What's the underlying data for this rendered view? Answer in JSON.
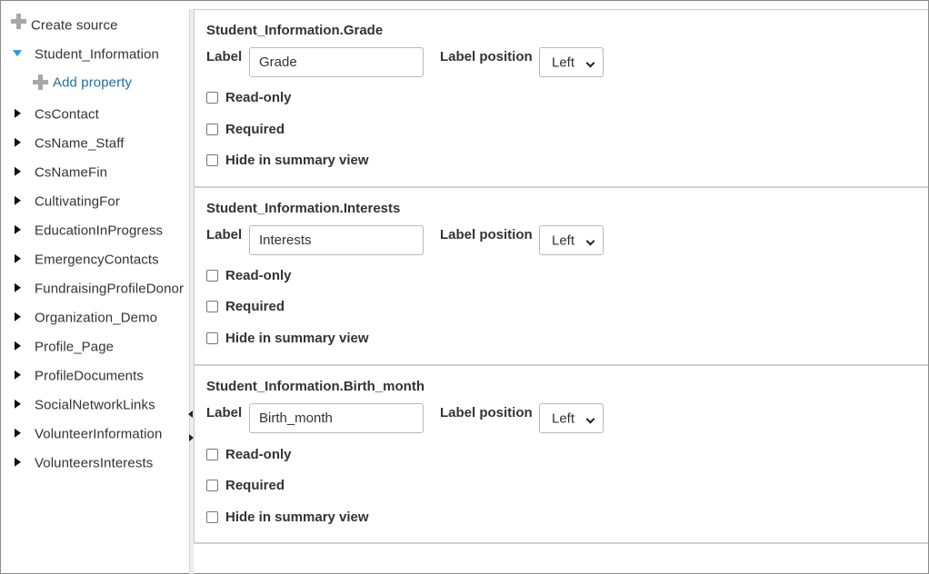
{
  "tree": {
    "create_source_label": "Create source",
    "expanded_item_label": "Student_Information",
    "add_property_label": "Add property",
    "items": [
      {
        "label": "CsContact"
      },
      {
        "label": "CsName_Staff"
      },
      {
        "label": "CsNameFin"
      },
      {
        "label": "CultivatingFor"
      },
      {
        "label": "EducationInProgress"
      },
      {
        "label": "EmergencyContacts"
      },
      {
        "label": "FundraisingProfileDonor"
      },
      {
        "label": "Organization_Demo"
      },
      {
        "label": "Profile_Page"
      },
      {
        "label": "ProfileDocuments"
      },
      {
        "label": "SocialNetworkLinks"
      },
      {
        "label": "VolunteerInformation"
      },
      {
        "label": "VolunteersInterests"
      }
    ]
  },
  "panels": [
    {
      "title": "Student_Information.Grade",
      "label_caption": "Label",
      "label_value": "Grade",
      "position_caption": "Label position",
      "position_value": "Left",
      "readonly_label": "Read-only",
      "required_label": "Required",
      "hide_label": "Hide in summary view"
    },
    {
      "title": "Student_Information.Interests",
      "label_caption": "Label",
      "label_value": "Interests",
      "position_caption": "Label position",
      "position_value": "Left",
      "readonly_label": "Read-only",
      "required_label": "Required",
      "hide_label": "Hide in summary view"
    },
    {
      "title": "Student_Information.Birth_month",
      "label_caption": "Label",
      "label_value": "Birth_month",
      "position_caption": "Label position",
      "position_value": "Left",
      "readonly_label": "Read-only",
      "required_label": "Required",
      "hide_label": "Hide in summary view"
    }
  ],
  "colors": {
    "expand_arrow": "#1e9ad6",
    "link": "#1f6fa3",
    "plus_icon": "#a7a7a7"
  }
}
